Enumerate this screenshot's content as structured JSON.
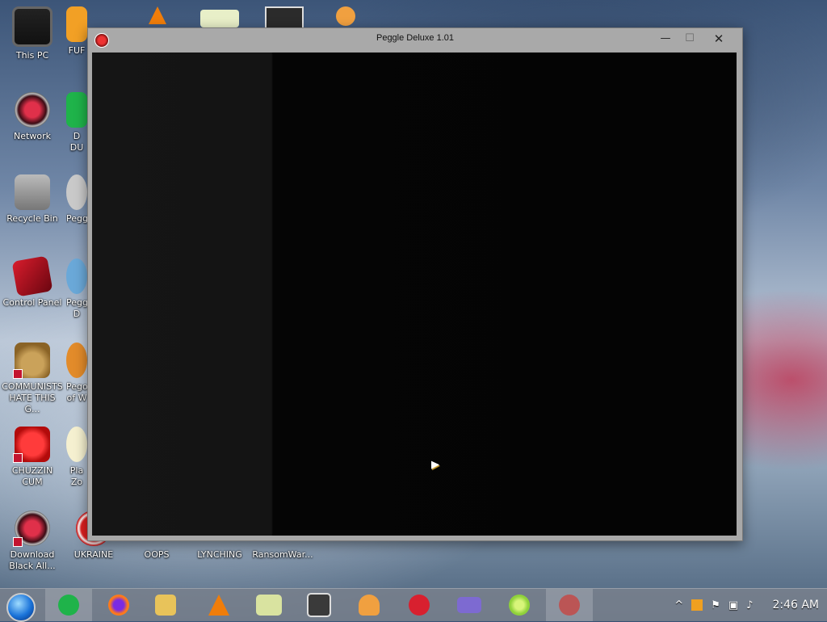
{
  "desktop": {
    "icons": [
      {
        "label": "This PC"
      },
      {
        "label": "Network"
      },
      {
        "label": "Recycle Bin"
      },
      {
        "label": "Control Panel"
      },
      {
        "label": "COMMUNISTS HATE THIS G..."
      },
      {
        "label": "CHUZZIN CUM"
      },
      {
        "label": "Download Black All..."
      },
      {
        "label": "FUF"
      },
      {
        "label": "D DU"
      },
      {
        "label": "Pegg"
      },
      {
        "label": "Pegg D"
      },
      {
        "label": "Pego of W"
      },
      {
        "label": "Pla Zo"
      },
      {
        "label": "UKRAINE"
      },
      {
        "label": "OOPS"
      },
      {
        "label": "LYNCHING"
      },
      {
        "label": "RansomWar..."
      }
    ]
  },
  "window": {
    "title": "Peggle Deluxe 1.01",
    "minimize_glyph": "—",
    "maximize_glyph": "☐",
    "close_glyph": "✕"
  },
  "taskbar": {
    "apps": [
      {
        "name": "notes",
        "color": "#1fb34a"
      },
      {
        "name": "firefox",
        "color": "#ff7a1a"
      },
      {
        "name": "file-explorer",
        "color": "#e8c35a"
      },
      {
        "name": "vlc",
        "color": "#f07d0a"
      },
      {
        "name": "hxd",
        "color": "#d9e3a0"
      },
      {
        "name": "app-square",
        "color": "#3a3a3a"
      },
      {
        "name": "person-app",
        "color": "#f0a040"
      },
      {
        "name": "dev-cpp",
        "color": "#d8202f"
      },
      {
        "name": "card-app",
        "color": "#7d6ad1"
      },
      {
        "name": "lime-app",
        "color": "#8fd13a"
      },
      {
        "name": "peggle",
        "color": "#b55"
      }
    ],
    "tray": {
      "up_arrow": "^",
      "clock": "2:46 AM"
    }
  }
}
